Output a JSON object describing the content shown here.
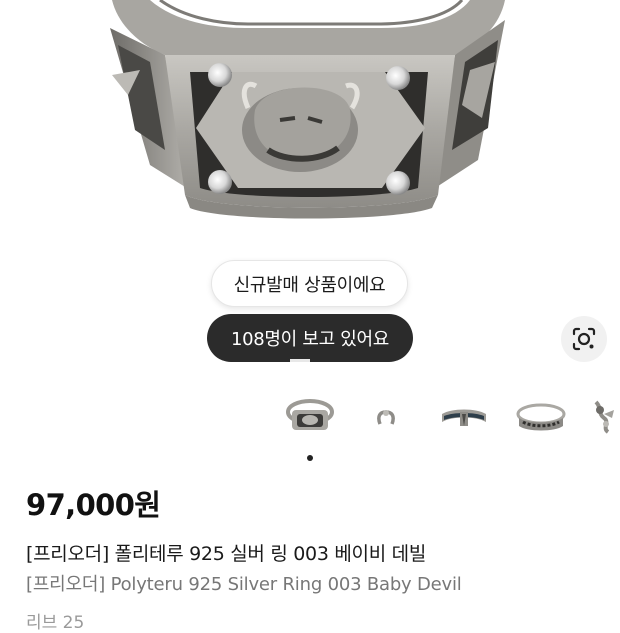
{
  "product_image": {
    "alt": "silver devil ring",
    "icon": "ring-photo"
  },
  "badge_new": {
    "label": "신규발매 상품이에요"
  },
  "viewers_pill": {
    "label": "108명이 보고 있어요",
    "progress_fraction": 0.1
  },
  "lens_button": {
    "icon": "camera-lens-icon"
  },
  "thumbnails": [
    {
      "icon": "ring-signet-thumb"
    },
    {
      "icon": "ring-small-thumb"
    },
    {
      "icon": "ring-band-enamel-thumb"
    },
    {
      "icon": "ring-band-patterned-thumb"
    },
    {
      "icon": "ring-ornate-thumb"
    }
  ],
  "pager": {
    "active_index": 0
  },
  "product": {
    "price": "97,000원",
    "title_ko": "[프리오더] 폴리테루 925 실버 링 003 베이비 데빌",
    "title_en": "[프리오더] Polyteru 925 Silver Ring 003 Baby Devil",
    "cut_text": "리브 25"
  },
  "colors": {
    "pill_dark": "#2b2b2b",
    "price": "#111111",
    "subtitle": "#777777"
  }
}
